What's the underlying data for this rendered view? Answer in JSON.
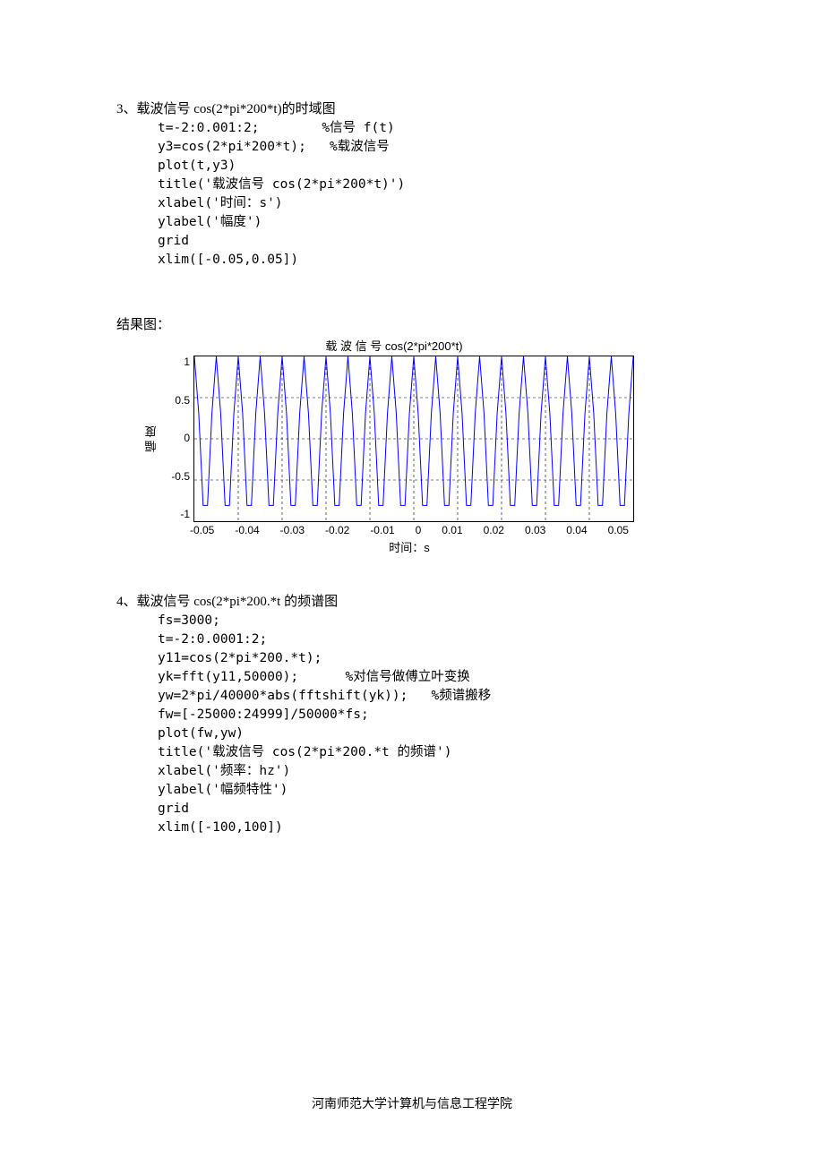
{
  "section3": {
    "title": "3、载波信号 cos(2*pi*200*t)的时域图",
    "code": "t=-2:0.001:2;        %信号 f(t)\ny3=cos(2*pi*200*t);   %载波信号\nplot(t,y3)\ntitle('载波信号 cos(2*pi*200*t)')\nxlabel('时间：s')\nylabel('幅度')\ngrid\nxlim([-0.05,0.05])"
  },
  "result_label": "结果图：",
  "chart": {
    "title": "载 波 信 号 cos(2*pi*200*t)",
    "ylabel": "幅 度",
    "xlabel": "时间：s",
    "yticks": [
      "1",
      "0.5",
      "0",
      "-0.5",
      "-1"
    ],
    "xticks": [
      "-0.05",
      "-0.04",
      "-0.03",
      "-0.02",
      "-0.01",
      "0",
      "0.01",
      "0.02",
      "0.03",
      "0.04",
      "0.05"
    ]
  },
  "section4": {
    "title": "4、载波信号 cos(2*pi*200.*t 的频谱图",
    "code": "fs=3000;\nt=-2:0.0001:2;\ny11=cos(2*pi*200.*t);\nyk=fft(y11,50000);      %对信号做傅立叶变换\nyw=2*pi/40000*abs(fftshift(yk));   %频谱搬移\nfw=[-25000:24999]/50000*fs;\nplot(fw,yw)\ntitle('载波信号 cos(2*pi*200.*t 的频谱')\nxlabel('频率：hz')\nylabel('幅频特性')\ngrid\nxlim([-100,100])"
  },
  "footer": "河南师范大学计算机与信息工程学院",
  "chart_data": {
    "type": "line",
    "title": "载波信号 cos(2*pi*200*t)",
    "xlabel": "时间：s",
    "ylabel": "幅度",
    "xlim": [
      -0.05,
      0.05
    ],
    "ylim": [
      -1,
      1
    ],
    "series": [
      {
        "name": "cos(2*pi*200*t)",
        "function": "cos(2*pi*200*t)",
        "sample_dt": 0.001,
        "frequency_hz": 200,
        "amplitude": 1,
        "x_range": [
          -0.05,
          0.05
        ]
      }
    ],
    "grid": true,
    "xticks": [
      -0.05,
      -0.04,
      -0.03,
      -0.02,
      -0.01,
      0,
      0.01,
      0.02,
      0.03,
      0.04,
      0.05
    ],
    "yticks": [
      -1,
      -0.5,
      0,
      0.5,
      1
    ]
  }
}
